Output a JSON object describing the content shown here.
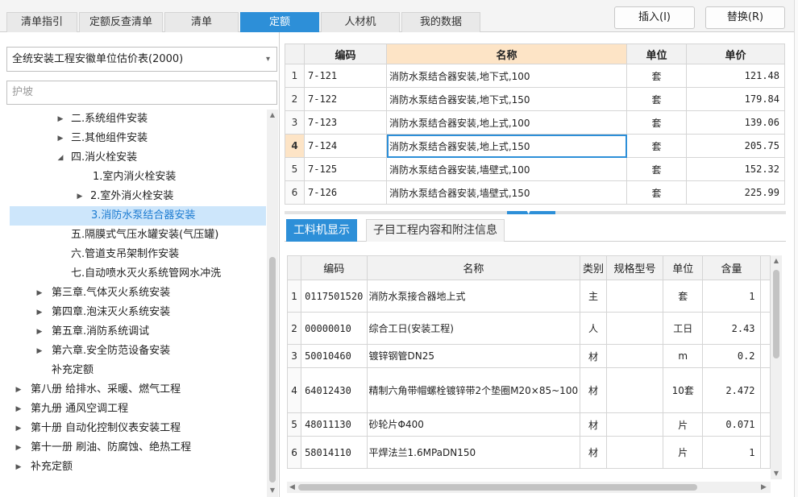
{
  "tabs": [
    "清单指引",
    "定额反查清单",
    "清单",
    "定额",
    "人材机",
    "我的数据"
  ],
  "active_tab": "定额",
  "buttons": {
    "insert": "插入(I)",
    "replace": "替换(R)"
  },
  "library_select": "全统安装工程安徽单位估价表(2000)",
  "search_value": "护坡",
  "tree": [
    "二.系统组件安装",
    "三.其他组件安装",
    "四.消火栓安装",
    "1.室内消火栓安装",
    "2.室外消火栓安装",
    "3.消防水泵结合器安装",
    "五.隔膜式气压水罐安装(气压罐)",
    "六.管道支吊架制作安装",
    "七.自动喷水灭火系统管网水冲洗",
    "第三章.气体灭火系统安装",
    "第四章.泡沫灭火系统安装",
    "第五章.消防系统调试",
    "第六章.安全防范设备安装",
    "补充定额",
    "第八册 给排水、采暖、燃气工程",
    "第九册 通风空调工程",
    "第十册 自动化控制仪表安装工程",
    "第十一册 刷油、防腐蚀、绝热工程",
    "补充定额"
  ],
  "quota_table": {
    "headers": [
      "编码",
      "名称",
      "单位",
      "单价"
    ],
    "rows": [
      {
        "no": "1",
        "code": "7-121",
        "name": "消防水泵结合器安装,地下式,100",
        "unit": "套",
        "price": "121.48"
      },
      {
        "no": "2",
        "code": "7-122",
        "name": "消防水泵结合器安装,地下式,150",
        "unit": "套",
        "price": "179.84"
      },
      {
        "no": "3",
        "code": "7-123",
        "name": "消防水泵结合器安装,地上式,100",
        "unit": "套",
        "price": "139.06"
      },
      {
        "no": "4",
        "code": "7-124",
        "name": "消防水泵结合器安装,地上式,150",
        "unit": "套",
        "price": "205.75"
      },
      {
        "no": "5",
        "code": "7-125",
        "name": "消防水泵结合器安装,墙壁式,100",
        "unit": "套",
        "price": "152.32"
      },
      {
        "no": "6",
        "code": "7-126",
        "name": "消防水泵结合器安装,墙壁式,150",
        "unit": "套",
        "price": "225.99"
      }
    ]
  },
  "bottom_tabs": [
    "工料机显示",
    "子目工程内容和附注信息"
  ],
  "material_table": {
    "headers": [
      "编码",
      "名称",
      "类别",
      "规格型号",
      "单位",
      "含量"
    ],
    "rows": [
      {
        "no": "1",
        "code": "0117501520",
        "name": "消防水泵接合器地上式",
        "type": "主",
        "spec": "",
        "unit": "套",
        "qty": "1"
      },
      {
        "no": "2",
        "code": "00000010",
        "name": "综合工日(安装工程)",
        "type": "人",
        "spec": "",
        "unit": "工日",
        "qty": "2.43"
      },
      {
        "no": "3",
        "code": "50010460",
        "name": "镀锌钢管DN25",
        "type": "材",
        "spec": "",
        "unit": "m",
        "qty": "0.2"
      },
      {
        "no": "4",
        "code": "64012430",
        "name": "精制六角带帽螺栓镀锌带2个垫圈M20×85~100",
        "type": "材",
        "spec": "",
        "unit": "10套",
        "qty": "2.472"
      },
      {
        "no": "5",
        "code": "48011130",
        "name": "砂轮片Φ400",
        "type": "材",
        "spec": "",
        "unit": "片",
        "qty": "0.071"
      },
      {
        "no": "6",
        "code": "58014110",
        "name": "平焊法兰1.6MPaDN150",
        "type": "材",
        "spec": "",
        "unit": "片",
        "qty": "1"
      }
    ]
  },
  "colors": {
    "accent": "#2d8fd8",
    "highlight": "#fde4c6",
    "selected": "#cde6fb"
  }
}
